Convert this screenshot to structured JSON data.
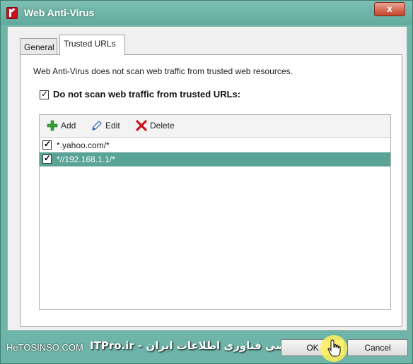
{
  "window": {
    "title": "Web Anti-Virus",
    "close_label": "x"
  },
  "tabs": [
    {
      "label": "General",
      "active": false
    },
    {
      "label": "Trusted URLs",
      "active": true
    }
  ],
  "trusted_urls": {
    "description": "Web Anti-Virus does not scan web traffic from trusted web resources.",
    "do_not_scan_label": "Do not scan web traffic from trusted URLs:",
    "do_not_scan_checked": true,
    "toolbar": {
      "add_label": "Add",
      "edit_label": "Edit",
      "delete_label": "Delete"
    },
    "urls": [
      {
        "url": "*.yahoo.com/*",
        "checked": true,
        "selected": false
      },
      {
        "url": "*//192.168.1.1/*",
        "checked": true,
        "selected": true
      }
    ]
  },
  "footer": {
    "help_label": "He",
    "watermark_site": "TOSINSO.COM",
    "watermark_text": "انجمن تخصصی فناوری اطلاعات ایران - ITPro.ir",
    "ok_label": "OK",
    "cancel_label": "Cancel"
  },
  "colors": {
    "frame": "#6fb4a8",
    "selection": "#5aa397",
    "close_button": "#c6432b"
  }
}
